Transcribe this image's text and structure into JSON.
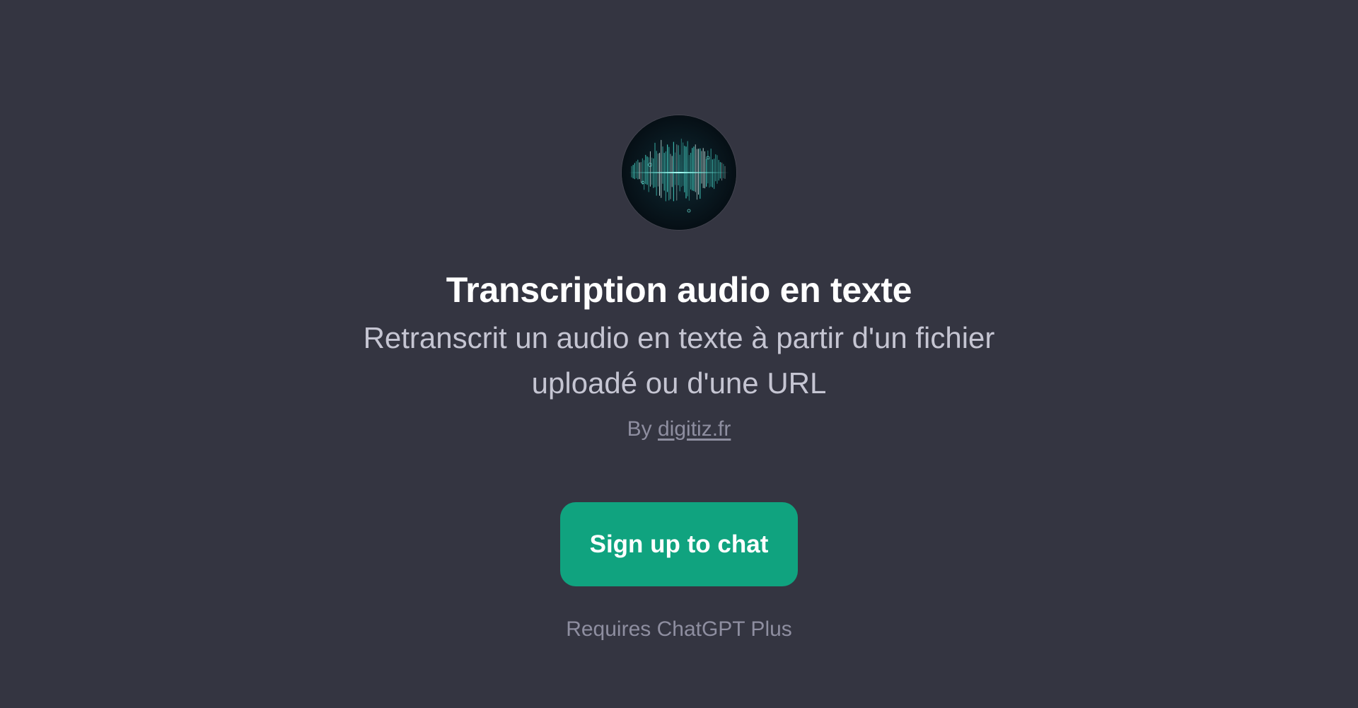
{
  "gpt": {
    "avatar_icon": "sound-wave-icon",
    "title": "Transcription audio en texte",
    "description": "Retranscrit un audio en texte à partir d'un fichier uploadé ou d'une URL",
    "by_prefix": "By",
    "author": "digitiz.fr"
  },
  "cta": {
    "label": "Sign up to chat"
  },
  "requirement": "Requires ChatGPT Plus",
  "colors": {
    "background": "#343541",
    "accent": "#10a37f",
    "title": "#ffffff",
    "subtitle": "#c5c5d2",
    "muted": "#8e8ea0"
  }
}
